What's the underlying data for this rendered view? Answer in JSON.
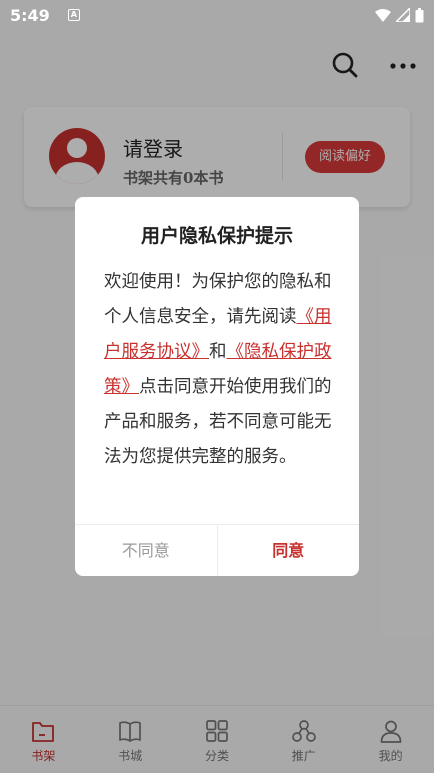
{
  "status_bar": {
    "time": "5:49",
    "notification_icon": "A"
  },
  "header": {
    "search_icon": "search-icon",
    "more_icon": "more-dots-icon"
  },
  "user_card": {
    "login_text": "请登录",
    "shelf_count_text": "书架共有0本书",
    "preference_button": "阅读偏好"
  },
  "dialog": {
    "title": "用户隐私保护提示",
    "body_part1": "欢迎使用！为保护您的隐私和个人信息安全，请先阅读",
    "link_service": "《用户服务协议》",
    "body_and": "和",
    "link_privacy": "《隐私保护政策》",
    "body_part2": "点击同意开始使用我们的产品和服务，若不同意可能无法为您提供完整的服务。",
    "disagree_label": "不同意",
    "agree_label": "同意"
  },
  "bottom_nav": {
    "items": [
      {
        "label": "书架",
        "icon": "bookshelf-icon",
        "active": true
      },
      {
        "label": "书城",
        "icon": "book-store-icon",
        "active": false
      },
      {
        "label": "分类",
        "icon": "category-grid-icon",
        "active": false
      },
      {
        "label": "推广",
        "icon": "share-icon",
        "active": false
      },
      {
        "label": "我的",
        "icon": "profile-icon",
        "active": false
      }
    ]
  },
  "colors": {
    "accent": "#c8312e",
    "overlay": "rgba(0,0,0,0.32)"
  }
}
